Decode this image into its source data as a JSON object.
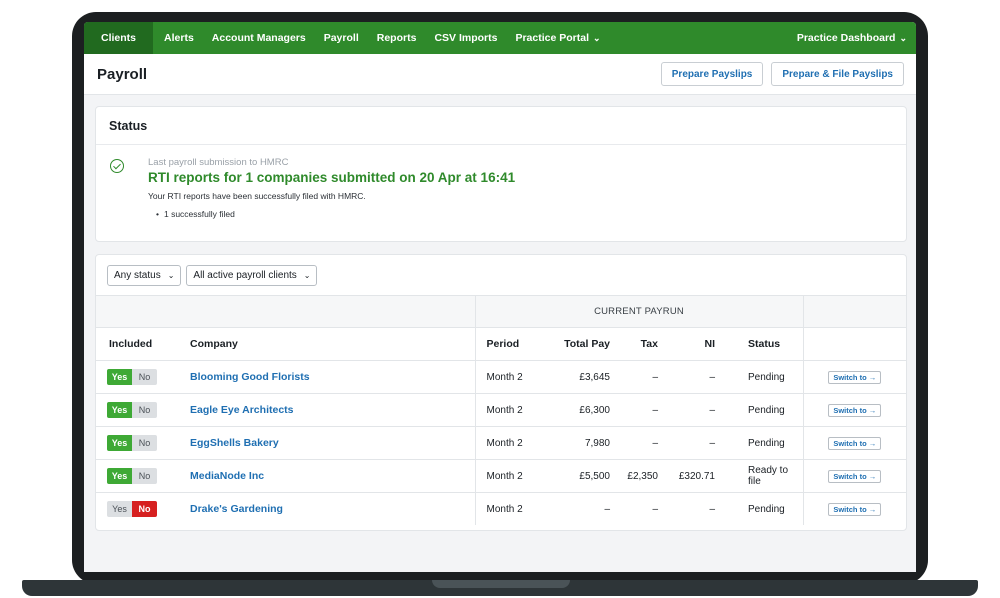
{
  "nav": {
    "items": [
      "Clients",
      "Alerts",
      "Account Managers",
      "Payroll",
      "Reports",
      "CSV Imports",
      "Practice Portal"
    ],
    "right": "Practice Dashboard"
  },
  "header": {
    "title": "Payroll",
    "prepare_payslips": "Prepare Payslips",
    "prepare_file": "Prepare & File Payslips"
  },
  "status": {
    "title": "Status",
    "sub": "Last payroll submission to HMRC",
    "headline": "RTI reports for 1 companies submitted on 20 Apr at 16:41",
    "body": "Your RTI reports have been successfully filed with HMRC.",
    "bullet": "1 successfully filed"
  },
  "filters": {
    "status": "Any status",
    "clients": "All active payroll clients"
  },
  "table": {
    "group_label": "CURRENT PAYRUN",
    "columns": {
      "included": "Included",
      "company": "Company",
      "period": "Period",
      "total_pay": "Total Pay",
      "tax": "Tax",
      "ni": "NI",
      "status": "Status"
    },
    "yes_label": "Yes",
    "no_label": "No",
    "switch_label": "Switch to →",
    "rows": [
      {
        "included": true,
        "company": "Blooming Good Florists",
        "period": "Month 2",
        "total_pay": "£3,645",
        "tax": "–",
        "ni": "–",
        "status": "Pending"
      },
      {
        "included": true,
        "company": "Eagle Eye Architects",
        "period": "Month 2",
        "total_pay": "£6,300",
        "tax": "–",
        "ni": "–",
        "status": "Pending"
      },
      {
        "included": true,
        "company": "EggShells Bakery",
        "period": "Month 2",
        "total_pay": "7,980",
        "tax": "–",
        "ni": "–",
        "status": "Pending"
      },
      {
        "included": true,
        "company": "MediaNode Inc",
        "period": "Month 2",
        "total_pay": "£5,500",
        "tax": "£2,350",
        "ni": "£320.71",
        "status": "Ready to file"
      },
      {
        "included": false,
        "company": "Drake's Gardening",
        "period": "Month 2",
        "total_pay": "–",
        "tax": "–",
        "ni": "–",
        "status": "Pending"
      }
    ]
  },
  "colors": {
    "brand_green": "#2f8a2b",
    "link_blue": "#1f6fb2",
    "no_red": "#d62020"
  }
}
